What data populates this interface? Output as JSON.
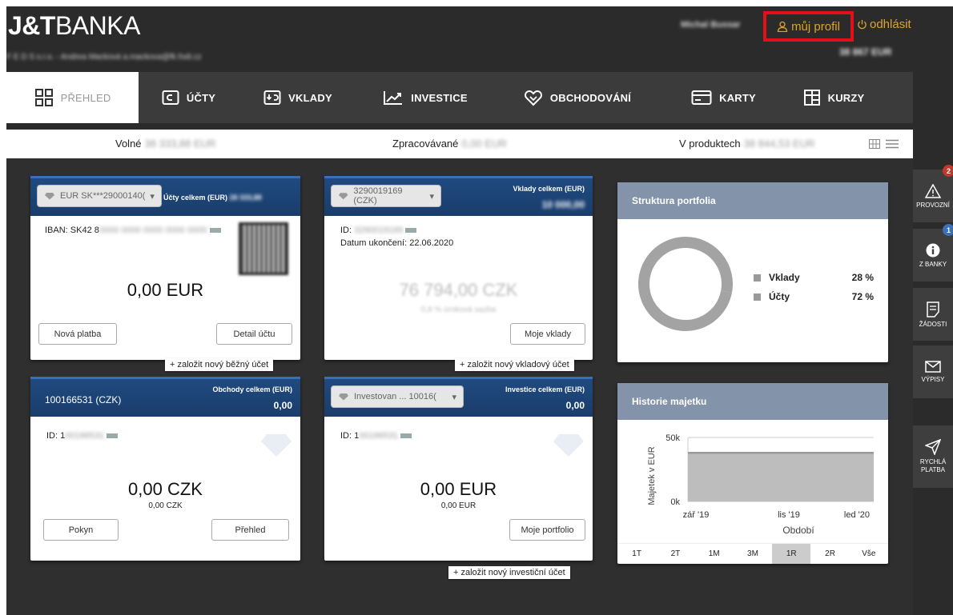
{
  "header": {
    "logo_bold": "J&T",
    "logo_rest": "BANKA",
    "account_line": "F E D S s.r.o. - Andrea Macková a.mackova@fk.fodi.cz",
    "user_name": "Michal Bussar",
    "profile_label": "můj profil",
    "logout_label": "odhlásit",
    "top_balance": "38 867 EUR"
  },
  "nav": {
    "items": [
      {
        "label": "PŘEHLED",
        "icon": "grid-icon"
      },
      {
        "label": "ÚČTY",
        "icon": "wallet-icon"
      },
      {
        "label": "VKLADY",
        "icon": "deposit-icon"
      },
      {
        "label": "INVESTICE",
        "icon": "chart-trend-icon"
      },
      {
        "label": "OBCHODOVÁNÍ",
        "icon": "handshake-icon"
      },
      {
        "label": "KARTY",
        "icon": "card-icon"
      },
      {
        "label": "KURZY",
        "icon": "table-icon"
      }
    ]
  },
  "summary": {
    "free_label": "Volné",
    "free_value": "38 333,88 EUR",
    "processing_label": "Zpracovávané",
    "processing_value": "0,00 EUR",
    "products_label": "V produktech",
    "products_value": "38 844,53 EUR"
  },
  "cards": {
    "accounts": {
      "selector": "EUR SK***29000140(",
      "total_label": "Účty celkem (EUR)",
      "total_value": "28 333,88",
      "iban": "IBAN: SK42 8",
      "iban_hidden": "0000 0000 0000 0000 0000",
      "amount": "0,00 EUR",
      "btn_new_payment": "Nová platba",
      "btn_detail": "Detail účtu",
      "add_link": "založit nový běžný účet"
    },
    "deposits": {
      "selector": "3290019169 (CZK)",
      "total_label": "Vklady celkem (EUR)",
      "total_value": "10 000,00",
      "id_label": "ID:",
      "id_hidden": "3290019169",
      "end_date": "Datum ukončení: 22.06.2020",
      "amount": "76 794,00 CZK",
      "amount_sub": "0,8 % úroková sazba",
      "btn_my_deposits": "Moje vklady",
      "add_link": "založit nový vkladový účet"
    },
    "trading": {
      "title": "100166531 (CZK)",
      "total_label": "Obchody celkem (EUR)",
      "total_value": "0,00",
      "id_label": "ID: 1",
      "id_hidden": "00166531",
      "amount": "0,00 CZK",
      "amount_sub": "0,00 CZK",
      "btn_order": "Pokyn",
      "btn_overview": "Přehled"
    },
    "investments": {
      "selector": "Investovan ... 10016(",
      "total_label": "Investice celkem (EUR)",
      "total_value": "0,00",
      "id_label": "ID: 1",
      "id_hidden": "00166531",
      "amount": "0,00 EUR",
      "amount_sub": "0,00 EUR",
      "btn_portfolio": "Moje portfolio",
      "add_link": "založit nový investiční účet"
    }
  },
  "portfolio": {
    "title": "Struktura portfolia",
    "legend": [
      {
        "label": "Vklady",
        "value": "28 %"
      },
      {
        "label": "Účty",
        "value": "72 %"
      }
    ]
  },
  "history": {
    "title": "Historie majetku",
    "periods": [
      "1T",
      "2T",
      "1M",
      "3M",
      "1R",
      "2R",
      "Vše"
    ],
    "selected_period": "1R"
  },
  "rail": {
    "items": [
      {
        "label": "PROVOZNÍ",
        "badge": "2",
        "badge_color": "#c0392b"
      },
      {
        "label": "Z BANKY",
        "badge": "1",
        "badge_color": "#3b6fb6"
      },
      {
        "label": "ŽÁDOSTI",
        "badge": ""
      },
      {
        "label": "VÝPISY",
        "badge": ""
      },
      {
        "label": "RYCHLÁ PLATBA",
        "badge": ""
      }
    ]
  },
  "colors": {
    "accent": "#e0a32c",
    "highlight_box": "#e3101a",
    "card_header": "#1f4a80",
    "panel_header": "#8393a9"
  },
  "chart_data": [
    {
      "type": "pie",
      "title": "Struktura portfolia",
      "categories": [
        "Vklady",
        "Účty"
      ],
      "values": [
        28,
        72
      ]
    },
    {
      "type": "area",
      "title": "Historie majetku",
      "xlabel": "Období",
      "ylabel": "Majetek v EUR",
      "x": [
        "zář '19",
        "lis '19",
        "led '20"
      ],
      "values": [
        38000,
        38000,
        38000
      ],
      "ylim": [
        0,
        50000
      ],
      "yticks": [
        "0k",
        "50k"
      ]
    }
  ]
}
